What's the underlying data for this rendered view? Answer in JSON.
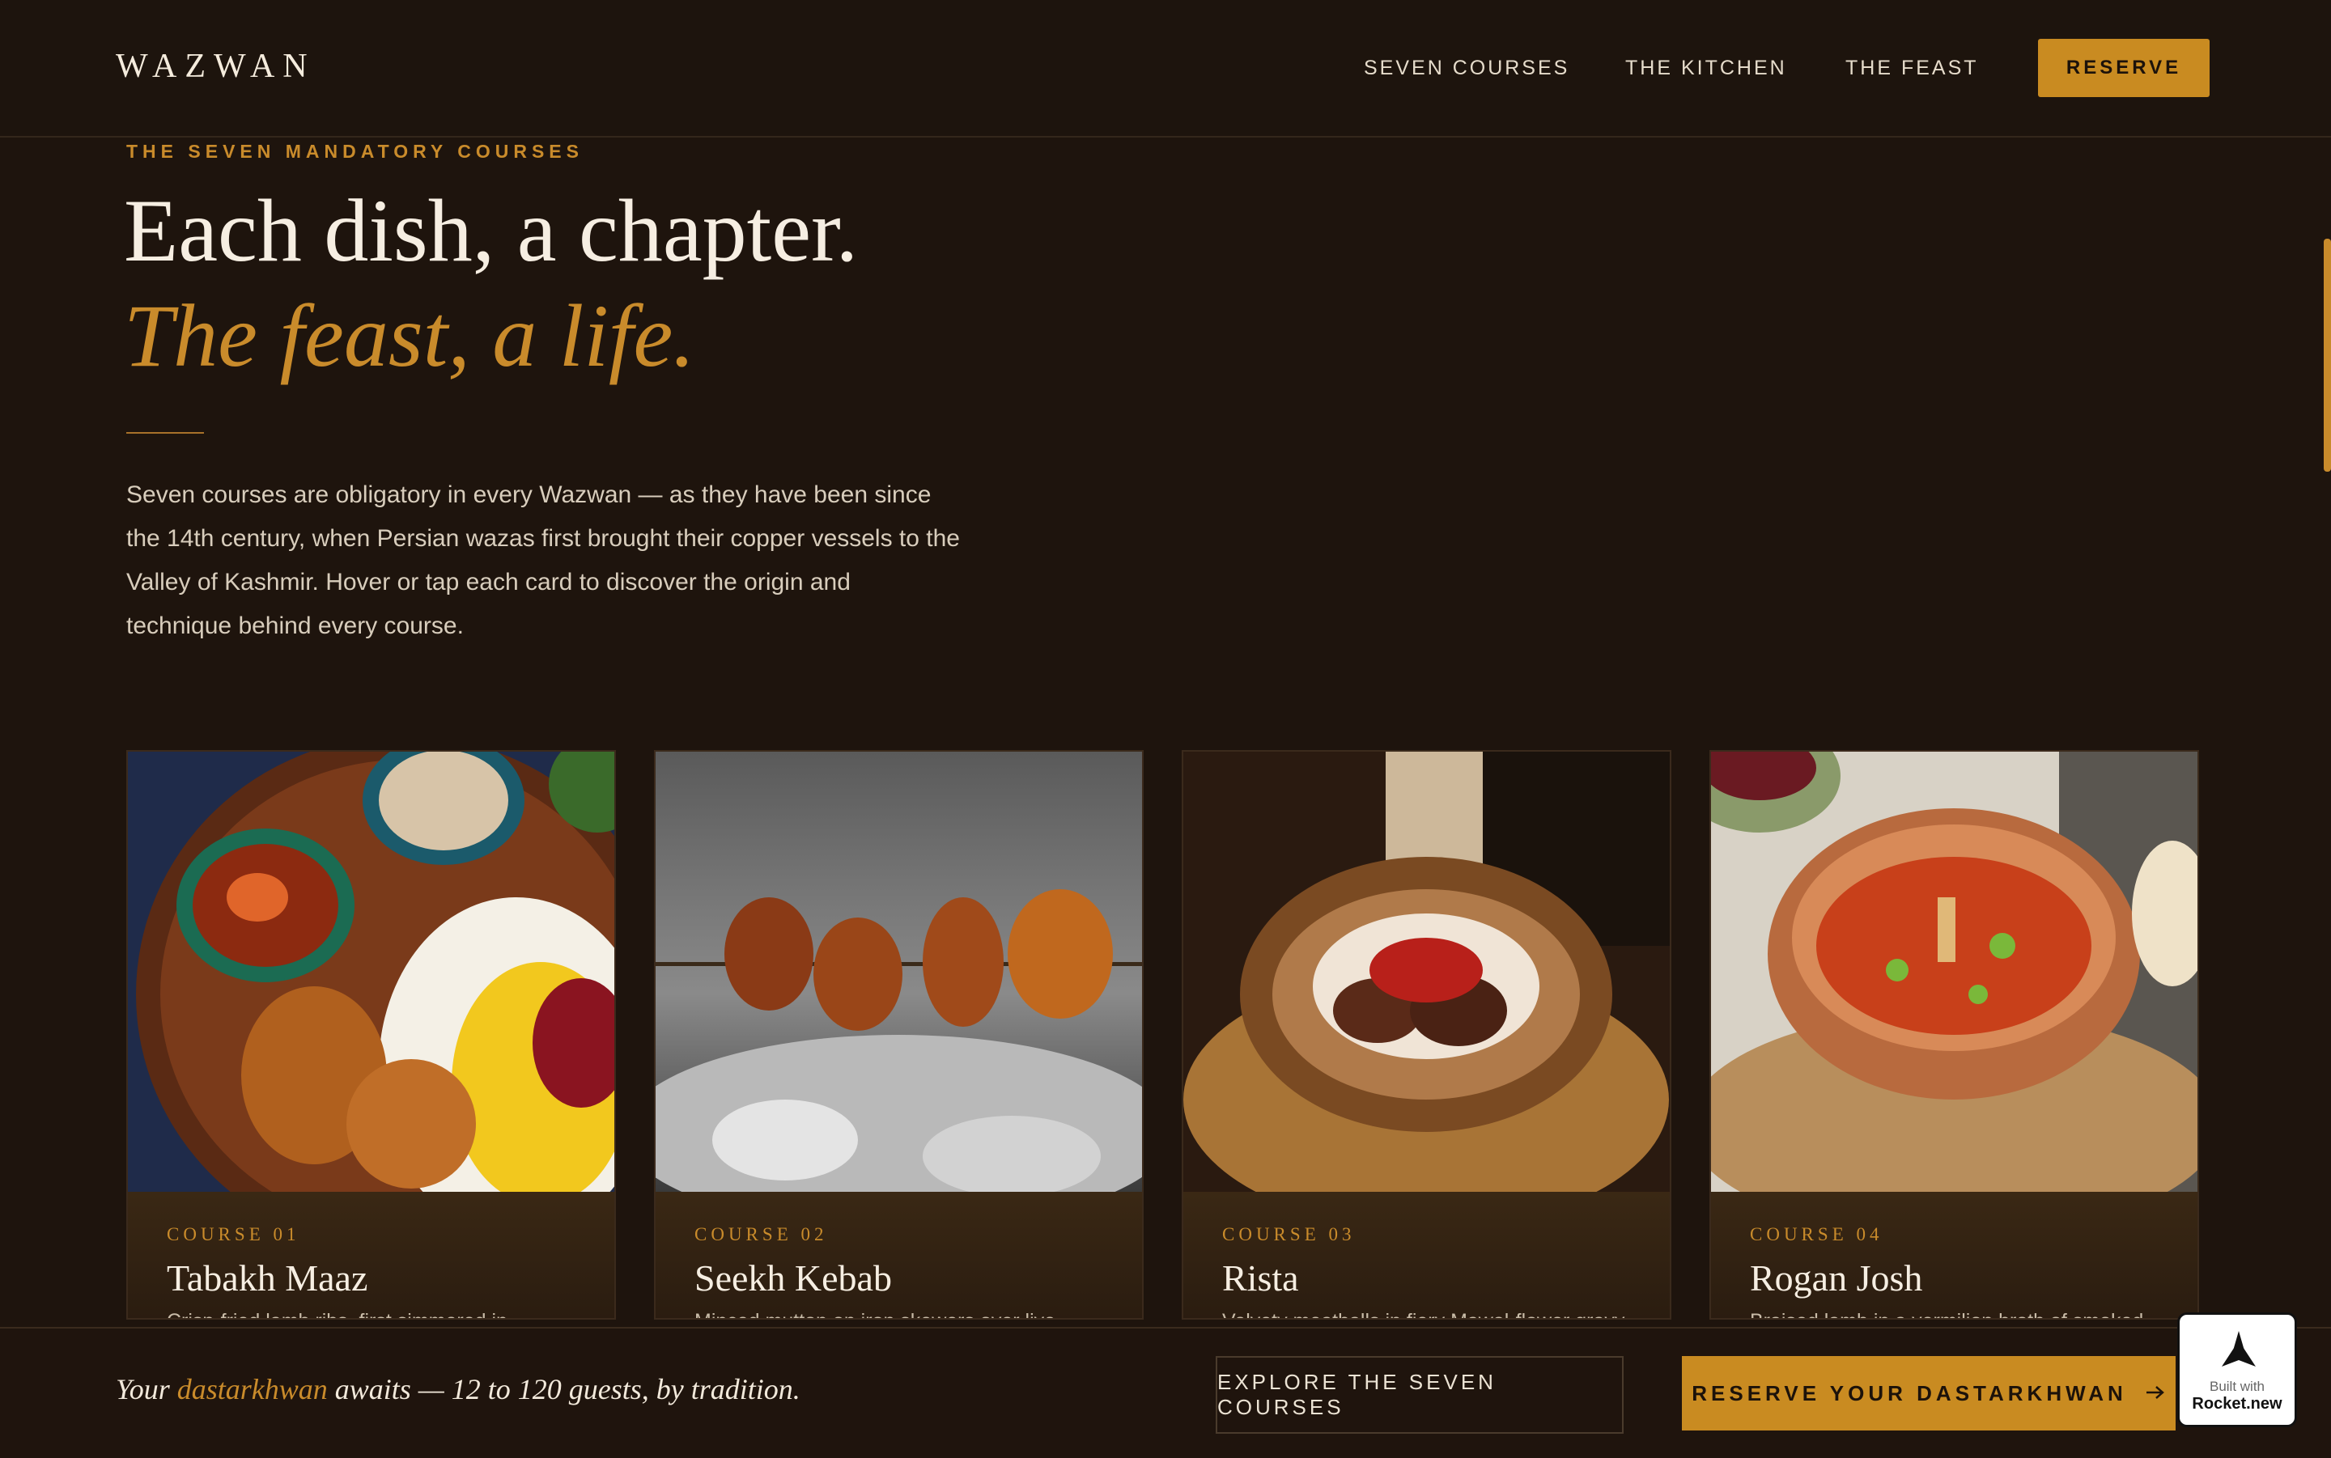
{
  "header": {
    "logo": "WAZWAN",
    "nav": [
      {
        "label": "SEVEN COURSES"
      },
      {
        "label": "THE KITCHEN"
      },
      {
        "label": "THE FEAST"
      }
    ],
    "reserve_label": "RESERVE"
  },
  "hero": {
    "eyebrow": "THE SEVEN MANDATORY COURSES",
    "title_line1": "Each dish, a chapter.",
    "title_line2": "The feast, a life.",
    "intro": "Seven courses are obligatory in every Wazwan — as they have been since the 14th century, when Persian wazas first brought their copper vessels to the Valley of Kashmir. Hover or tap each card to discover the origin and technique behind every course."
  },
  "cards": [
    {
      "num": "COURSE 01",
      "name": "Tabakh Maaz",
      "desc": "Crisp-fried lamb ribs, first simmered in",
      "image": "platter-of-rice-and-curries"
    },
    {
      "num": "COURSE 02",
      "name": "Seekh Kebab",
      "desc": "Minced mutton on iron skewers over live",
      "image": "kebab-skewer-over-coals"
    },
    {
      "num": "COURSE 03",
      "name": "Rista",
      "desc": "Velvety meatballs in fiery Mawal-flower gravy",
      "image": "meatballs-in-copper-pan"
    },
    {
      "num": "COURSE 04",
      "name": "Rogan Josh",
      "desc": "Braised lamb in a vermilion broth of smoked",
      "image": "curry-in-copper-bowl"
    }
  ],
  "footer": {
    "tagline_pre": "Your ",
    "tagline_accent": "dastarkhwan",
    "tagline_post": " awaits — 12 to 120 guests, by tradition.",
    "explore_label": "EXPLORE THE SEVEN COURSES",
    "reserve_label": "RESERVE YOUR DASTARKHWAN",
    "badge_small": "Built with",
    "badge_big": "Rocket.new"
  },
  "colors": {
    "background": "#1e140d",
    "accent": "#c98b21",
    "text": "#f6eee2"
  },
  "icons": [
    "arrow-right-icon",
    "rocket-icon"
  ]
}
